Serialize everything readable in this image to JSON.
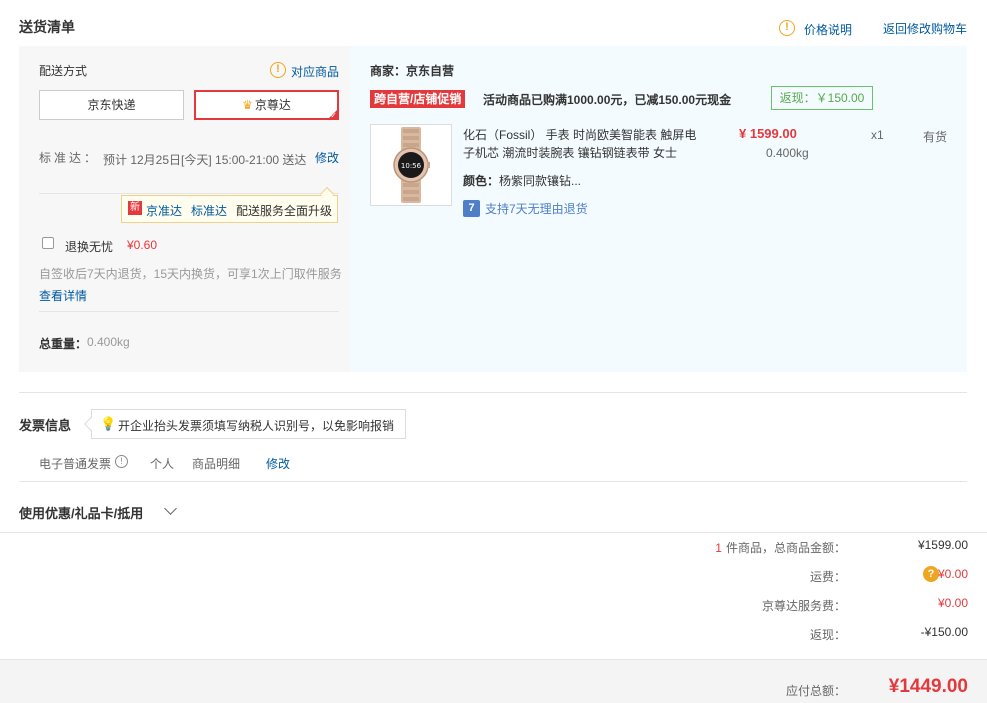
{
  "header": {
    "title": "送货清单",
    "price_note": "价格说明",
    "back_to_cart": "返回修改购物车"
  },
  "delivery": {
    "method_label": "配送方式",
    "goods_link": "对应商品",
    "options": [
      {
        "label": "京东快递",
        "selected": false
      },
      {
        "label": "京尊达",
        "selected": true
      }
    ],
    "eta_label": "标准达：",
    "eta_text": "预计 12月25日[今天] 15:00-21:00 送达",
    "eta_edit": "修改",
    "upgrade": {
      "badge": "新",
      "jzd": "京准达",
      "bzd": "标准达",
      "text": "配送服务全面升级"
    },
    "return_service": {
      "label": "退换无忧",
      "price": "¥0.60",
      "desc": "自签收后7天内退货，15天内换货，可享1次上门取件服务",
      "detail_link": "查看详情"
    },
    "weight_label": "总重量：",
    "weight_value": "0.400kg"
  },
  "goods": {
    "merchant": "商家：京东自营",
    "promo_tag": "跨自营/店铺促销",
    "promo_text": "活动商品已购满1000.00元，已减150.00元现金",
    "rebate": "返现：￥150.00",
    "product": {
      "name": "化石（Fossil） 手表 时尚欧美智能表 触屏电子机芯 潮流时装腕表 镶钻钢链表带 女士",
      "price": "¥ 1599.00",
      "qty": "x1",
      "stock": "有货",
      "weight": "0.400kg",
      "color_label": "颜色：",
      "color_value": "杨紫同款镶钻...",
      "return_badge": "7",
      "return_text": "支持7天无理由退货",
      "watch_time": "10:56"
    }
  },
  "invoice": {
    "title": "发票信息",
    "tip": "开企业抬头发票须填写纳税人识别号，以免影响报销",
    "type": "电子普通发票",
    "person": "个人",
    "detail": "商品明细",
    "edit": "修改"
  },
  "coupon": {
    "title": "使用优惠/礼品卡/抵用"
  },
  "summary": {
    "count": "1",
    "count_text": "件商品，总商品金额：",
    "goods_total": "¥1599.00",
    "shipping_label": "运费：",
    "shipping_value": "¥0.00",
    "service_label": "京尊达服务费：",
    "service_value": "¥0.00",
    "rebate_label": "返现：",
    "rebate_value": "-¥150.00",
    "total_label": "应付总额：",
    "total_value": "¥1449.00"
  }
}
